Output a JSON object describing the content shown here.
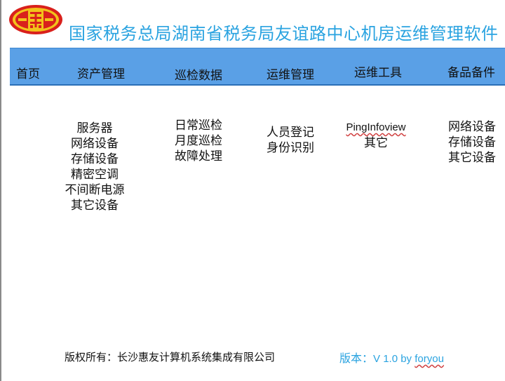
{
  "header": {
    "title": "国家税务总局湖南省税务局友谊路中心机房运维管理软件"
  },
  "nav": {
    "items": [
      "首页",
      "资产管理",
      "巡检数据",
      "运维管理",
      "运维工具",
      "备品备件"
    ]
  },
  "menus": {
    "assets": [
      "服务器",
      "网络设备",
      "存储设备",
      "精密空调",
      "不间断电源",
      "其它设备"
    ],
    "inspection": [
      "日常巡检",
      "月度巡检",
      "故障处理"
    ],
    "ops": [
      "人员登记",
      "身份识别"
    ],
    "tools": [
      "PingInfoview",
      "其它"
    ],
    "spares": [
      "网络设备",
      "存储设备",
      "其它设备"
    ]
  },
  "footer": {
    "copyright": "版权所有：长沙惠友计算机系统集成有限公司",
    "version_label": "版本：",
    "version_text": "V 1.0 by ",
    "version_author": "foryou"
  },
  "colors": {
    "title": "#2aa3e0",
    "navbar": "#5aa0e6",
    "logo_red": "#d9201c",
    "logo_gold": "#f2c21b"
  }
}
